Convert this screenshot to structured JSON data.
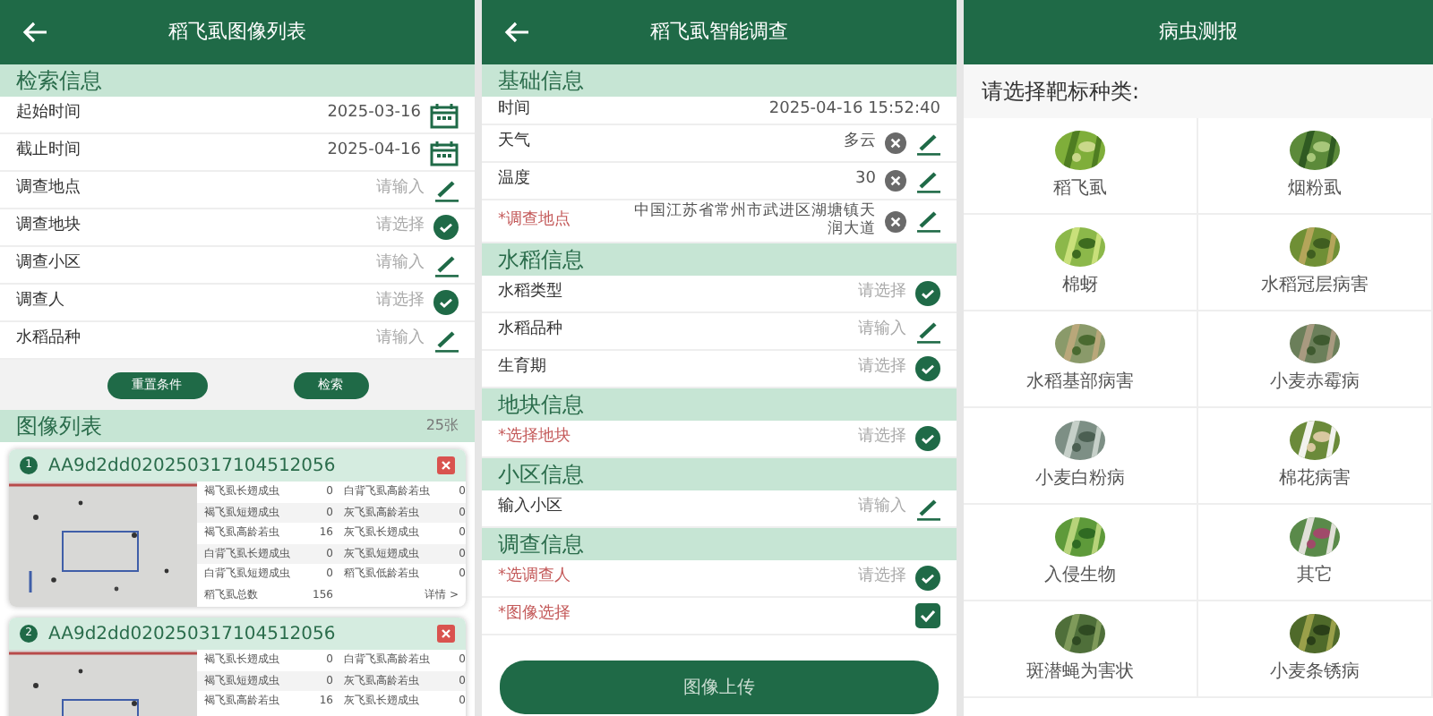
{
  "image_list_screen": {
    "title": "稻飞虱图像列表",
    "search_section": {
      "heading": "检索信息",
      "fields": [
        {
          "kind": "date",
          "label": "起始时间",
          "value": "2025-03-16"
        },
        {
          "kind": "date",
          "label": "截止时间",
          "value": "2025-04-16"
        },
        {
          "kind": "input",
          "label": "调查地点",
          "placeholder": "请输入"
        },
        {
          "kind": "select",
          "label": "调查地块",
          "placeholder": "请选择"
        },
        {
          "kind": "input",
          "label": "调查小区",
          "placeholder": "请输入"
        },
        {
          "kind": "select",
          "label": "调查人",
          "placeholder": "请选择"
        },
        {
          "kind": "input",
          "label": "水稻品种",
          "placeholder": "请输入"
        }
      ]
    },
    "buttons": [
      "重置条件",
      "检索"
    ],
    "list_section": {
      "heading": "图像列表",
      "count": "25张",
      "cards": [
        {
          "number": "1",
          "record_id": "AA9d2dd020250317104512056",
          "rows": [
            [
              "褐飞虱长翅成虫",
              "0",
              "白背飞虱高龄若虫",
              "0"
            ],
            [
              "褐飞虱短翅成虫",
              "0",
              "灰飞虱高龄若虫",
              "0"
            ],
            [
              "褐飞虱高龄若虫",
              "16",
              "灰飞虱长翅成虫",
              "0"
            ],
            [
              "白背飞虱长翅成虫",
              "0",
              "灰飞虱短翅成虫",
              "0"
            ],
            [
              "白背飞虱短翅成虫",
              "0",
              "稻飞虱低龄若虫",
              "0"
            ]
          ],
          "total_label": "稻飞虱总数",
          "total": "156",
          "details": "详情 >"
        },
        {
          "number": "2",
          "record_id": "AA9d2dd020250317104512056",
          "rows": [
            [
              "褐飞虱长翅成虫",
              "0",
              "白背飞虱高龄若虫",
              "0"
            ],
            [
              "褐飞虱短翅成虫",
              "0",
              "灰飞虱高龄若虫",
              "0"
            ],
            [
              "褐飞虱高龄若虫",
              "16",
              "灰飞虱长翅成虫",
              "0"
            ]
          ]
        }
      ]
    }
  },
  "survey_screen": {
    "title": "稻飞虱智能调查",
    "sections": [
      {
        "heading": "基础信息",
        "fields": [
          {
            "kind": "text",
            "label": "时间",
            "value": "2025-04-16 15:52:40",
            "required": false
          },
          {
            "kind": "clearable",
            "label": "天气",
            "value": "多云",
            "required": false
          },
          {
            "kind": "clearable",
            "label": "温度",
            "value": "30",
            "required": false
          },
          {
            "kind": "clearable",
            "label": "*调查地点",
            "value": "中国江苏省常州市武进区湖塘镇天润大道",
            "required": true
          }
        ]
      },
      {
        "heading": "水稻信息",
        "fields": [
          {
            "kind": "select",
            "label": "水稻类型",
            "placeholder": "请选择",
            "required": false
          },
          {
            "kind": "input",
            "label": "水稻品种",
            "placeholder": "请输入",
            "required": false
          },
          {
            "kind": "select",
            "label": "生育期",
            "placeholder": "请选择",
            "required": false
          }
        ]
      },
      {
        "heading": "地块信息",
        "fields": [
          {
            "kind": "select",
            "label": "*选择地块",
            "placeholder": "请选择",
            "required": true
          }
        ]
      },
      {
        "heading": "小区信息",
        "fields": [
          {
            "kind": "input",
            "label": "输入小区",
            "placeholder": "请输入",
            "required": false
          }
        ]
      },
      {
        "heading": "调查信息",
        "fields": [
          {
            "kind": "select",
            "label": "*选调查人",
            "placeholder": "请选择",
            "required": true
          },
          {
            "kind": "checkbox",
            "label": "*图像选择",
            "checked": true,
            "required": true
          }
        ]
      }
    ],
    "submit_button": "图像上传"
  },
  "pest_screen": {
    "title": "病虫测报",
    "prompt": "请选择靶标种类:",
    "targets": [
      {
        "label": "稻飞虱"
      },
      {
        "label": "烟粉虱"
      },
      {
        "label": "棉蚜"
      },
      {
        "label": "水稻冠层病害"
      },
      {
        "label": "水稻基部病害"
      },
      {
        "label": "小麦赤霉病"
      },
      {
        "label": "小麦白粉病"
      },
      {
        "label": "棉花病害"
      },
      {
        "label": "入侵生物"
      },
      {
        "label": "其它"
      },
      {
        "label": "斑潜蝇为害状"
      },
      {
        "label": "小麦条锈病"
      }
    ]
  }
}
